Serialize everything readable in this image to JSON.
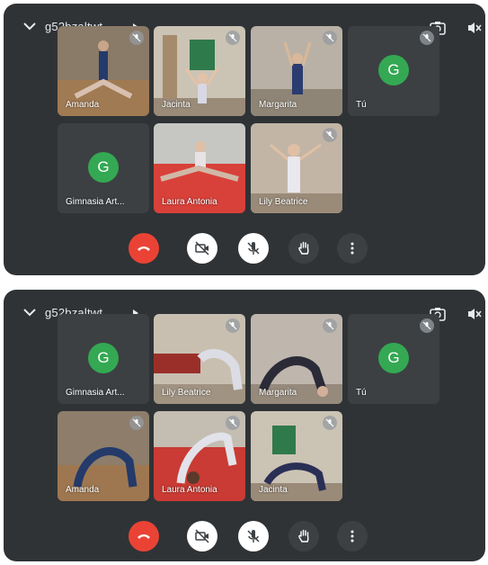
{
  "colors": {
    "panel": "#2f3336",
    "tile": "#3c4043",
    "avatar": "#34a853",
    "end_call": "#ea4335"
  },
  "icons": [
    "chevron-down-icon",
    "caret-right-icon",
    "camera-switch-icon",
    "speaker-off-icon",
    "mic-off-icon",
    "end-call-icon",
    "camera-off-icon",
    "raise-hand-icon",
    "more-vert-icon"
  ],
  "top": {
    "meeting_code": "g52bzaltwt",
    "tiles": [
      {
        "name": "Amanda"
      },
      {
        "name": "Jacinta"
      },
      {
        "name": "Margarita"
      },
      {
        "name": "Tú",
        "initial": "G"
      },
      {
        "name": "Gimnasia Art...",
        "initial": "G"
      },
      {
        "name": "Laura Antonia"
      },
      {
        "name": "Lily Beatrice"
      }
    ]
  },
  "bottom": {
    "meeting_code": "g52bzaltwt",
    "tiles": [
      {
        "name": "Gimnasia Art...",
        "initial": "G"
      },
      {
        "name": "Lily Beatrice"
      },
      {
        "name": "Margarita"
      },
      {
        "name": "Tú",
        "initial": "G"
      },
      {
        "name": "Amanda"
      },
      {
        "name": "Laura Antonia"
      },
      {
        "name": "Jacinta"
      }
    ]
  }
}
